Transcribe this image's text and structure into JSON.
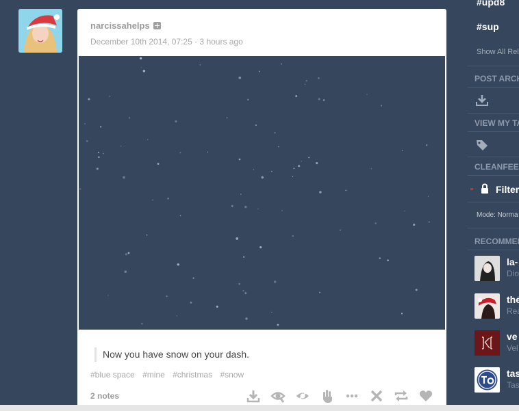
{
  "post": {
    "blog_name": "narcissahelps",
    "timestamp": "December 10th 2014, 07:25 · 3 hours ago",
    "caption": "Now you have snow on your dash.",
    "tags": [
      "#blue space",
      "#mine",
      "#christmas",
      "#snow"
    ],
    "notes": "2 notes",
    "media_background": "#36465d",
    "actions": [
      "download-icon",
      "eye-icon",
      "hide-eye-icon",
      "hand-icon",
      "more-icon",
      "close-icon",
      "reblog-icon",
      "heart-icon"
    ]
  },
  "sidebar": {
    "tags": [
      "#upd8",
      "#sup"
    ],
    "show_all": "Show All Rel",
    "sections": {
      "post_archive": "POST ARCH",
      "view_tags": "VIEW MY TA",
      "cleanfeed": "CLEANFEED",
      "recommended": "RECOMMEN"
    },
    "filter_label": "Filter",
    "mode_label": "Mode: Norma",
    "recommended": [
      {
        "name": "la-",
        "sub": "Dio"
      },
      {
        "name": "the",
        "sub": "Rea"
      },
      {
        "name": "ve",
        "sub": "Vel"
      },
      {
        "name": "tas",
        "sub": "Tas"
      }
    ]
  },
  "colors": {
    "dashboard_bg": "#36465d",
    "post_bg": "#ffffff",
    "muted_text": "#a8a8a8",
    "icon_gray": "#b5b5b5"
  }
}
